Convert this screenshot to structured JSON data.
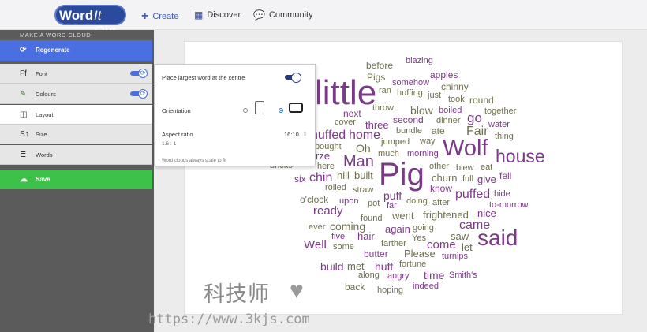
{
  "header": {
    "logo_word": "Word",
    "logo_itout": "It Out",
    "nav": [
      {
        "label": "Create",
        "icon": "plus-icon"
      },
      {
        "label": "Discover",
        "icon": "grid-icon"
      },
      {
        "label": "Community",
        "icon": "chat-icon"
      }
    ]
  },
  "sidebar": {
    "title": "MAKE A WORD CLOUD",
    "regenerate": "Regenerate",
    "items": [
      {
        "label": "Font",
        "icon": "font-icon"
      },
      {
        "label": "Colours",
        "icon": "brush-icon"
      },
      {
        "label": "Layout",
        "icon": "layout-icon"
      },
      {
        "label": "Size",
        "icon": "size-icon"
      },
      {
        "label": "Words",
        "icon": "words-icon"
      }
    ],
    "save": "Save"
  },
  "popover": {
    "center_label": "Place largest word at the centre",
    "orientation_label": "Orientation",
    "aspect_label": "Aspect ratio",
    "aspect_value": "16:10",
    "aspect_ratio_text": "1.6 : 1",
    "note": "Word clouds always scale to fit"
  },
  "cloud": {
    "colors": {
      "purple": "#7a3a87",
      "olive": "#6f6f4e"
    },
    "words": [
      {
        "text": "Pig",
        "color": "purple"
      },
      {
        "text": "little",
        "color": "purple"
      },
      {
        "text": "Wolf",
        "color": "purple"
      },
      {
        "text": "house",
        "color": "purple"
      },
      {
        "text": "said",
        "color": "purple"
      },
      {
        "text": "Man",
        "color": "purple"
      },
      {
        "text": "puffed",
        "color": "purple"
      },
      {
        "text": "Fair",
        "color": "olive"
      },
      {
        "text": "go",
        "color": "purple"
      },
      {
        "text": "came",
        "color": "purple"
      },
      {
        "text": "huffed",
        "color": "purple"
      },
      {
        "text": "chin",
        "color": "purple"
      },
      {
        "text": "home",
        "color": "purple"
      },
      {
        "text": "ready",
        "color": "purple"
      },
      {
        "text": "Pigs",
        "color": "olive"
      },
      {
        "text": "before",
        "color": "olive"
      },
      {
        "text": "blazing",
        "color": "purple"
      },
      {
        "text": "apples",
        "color": "purple"
      },
      {
        "text": "chinny",
        "color": "olive"
      },
      {
        "text": "somehow",
        "color": "purple"
      },
      {
        "text": "ran",
        "color": "olive"
      },
      {
        "text": "huffing",
        "color": "olive"
      },
      {
        "text": "just",
        "color": "olive"
      },
      {
        "text": "took",
        "color": "olive"
      },
      {
        "text": "round",
        "color": "olive"
      },
      {
        "text": "blow",
        "color": "olive"
      },
      {
        "text": "throw",
        "color": "olive"
      },
      {
        "text": "boiled",
        "color": "purple"
      },
      {
        "text": "together",
        "color": "olive"
      },
      {
        "text": "next",
        "color": "purple"
      },
      {
        "text": "cover",
        "color": "olive"
      },
      {
        "text": "second",
        "color": "purple"
      },
      {
        "text": "dinner",
        "color": "olive"
      },
      {
        "text": "water",
        "color": "purple"
      },
      {
        "text": "three",
        "color": "purple"
      },
      {
        "text": "bundle",
        "color": "olive"
      },
      {
        "text": "ate",
        "color": "olive"
      },
      {
        "text": "thing",
        "color": "olive"
      },
      {
        "text": "jumped",
        "color": "olive"
      },
      {
        "text": "way",
        "color": "olive"
      },
      {
        "text": "bought",
        "color": "olive"
      },
      {
        "text": "Oh",
        "color": "olive"
      },
      {
        "text": "much",
        "color": "olive"
      },
      {
        "text": "morning",
        "color": "purple"
      },
      {
        "text": "rze",
        "color": "purple"
      },
      {
        "text": "bricks",
        "color": "olive"
      },
      {
        "text": "here",
        "color": "olive"
      },
      {
        "text": "other",
        "color": "olive"
      },
      {
        "text": "blew",
        "color": "olive"
      },
      {
        "text": "eat",
        "color": "olive"
      },
      {
        "text": "six",
        "color": "purple"
      },
      {
        "text": "hill",
        "color": "olive"
      },
      {
        "text": "built",
        "color": "olive"
      },
      {
        "text": "churn",
        "color": "olive"
      },
      {
        "text": "full",
        "color": "olive"
      },
      {
        "text": "give",
        "color": "purple"
      },
      {
        "text": "fell",
        "color": "purple"
      },
      {
        "text": "rolled",
        "color": "olive"
      },
      {
        "text": "straw",
        "color": "olive"
      },
      {
        "text": "know",
        "color": "purple"
      },
      {
        "text": "hide",
        "color": "purple"
      },
      {
        "text": "o'clock",
        "color": "olive"
      },
      {
        "text": "puff",
        "color": "purple"
      },
      {
        "text": "upon",
        "color": "purple"
      },
      {
        "text": "pot",
        "color": "olive"
      },
      {
        "text": "far",
        "color": "purple"
      },
      {
        "text": "doing",
        "color": "olive"
      },
      {
        "text": "after",
        "color": "olive"
      },
      {
        "text": "to-morrow",
        "color": "purple"
      },
      {
        "text": "went",
        "color": "olive"
      },
      {
        "text": "frightened",
        "color": "olive"
      },
      {
        "text": "nice",
        "color": "purple"
      },
      {
        "text": "found",
        "color": "olive"
      },
      {
        "text": "ever",
        "color": "olive"
      },
      {
        "text": "coming",
        "color": "olive"
      },
      {
        "text": "again",
        "color": "purple"
      },
      {
        "text": "going",
        "color": "olive"
      },
      {
        "text": "five",
        "color": "purple"
      },
      {
        "text": "hair",
        "color": "purple"
      },
      {
        "text": "Yes",
        "color": "olive"
      },
      {
        "text": "saw",
        "color": "olive"
      },
      {
        "text": "Well",
        "color": "purple"
      },
      {
        "text": "some",
        "color": "olive"
      },
      {
        "text": "farther",
        "color": "olive"
      },
      {
        "text": "come",
        "color": "purple"
      },
      {
        "text": "let",
        "color": "olive"
      },
      {
        "text": "butter",
        "color": "purple"
      },
      {
        "text": "Please",
        "color": "olive"
      },
      {
        "text": "turnips",
        "color": "purple"
      },
      {
        "text": "build",
        "color": "purple"
      },
      {
        "text": "met",
        "color": "olive"
      },
      {
        "text": "huff",
        "color": "purple"
      },
      {
        "text": "fortune",
        "color": "olive"
      },
      {
        "text": "along",
        "color": "olive"
      },
      {
        "text": "angry",
        "color": "purple"
      },
      {
        "text": "time",
        "color": "purple"
      },
      {
        "text": "Smith's",
        "color": "purple"
      },
      {
        "text": "back",
        "color": "olive"
      },
      {
        "text": "hoping",
        "color": "olive"
      },
      {
        "text": "indeed",
        "color": "purple"
      }
    ]
  },
  "watermark": {
    "brand": "科技师",
    "url": "https://www.3kjs.com"
  }
}
